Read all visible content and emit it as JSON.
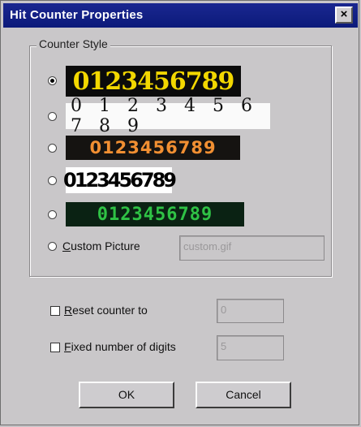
{
  "dialog": {
    "title": "Hit Counter Properties",
    "close_glyph": "×"
  },
  "counter_style": {
    "legend": "Counter Style",
    "options": [
      {
        "digits": "0123456789",
        "selected": true
      },
      {
        "digits": "0 1 2 3 4 5 6 7 8 9",
        "selected": false
      },
      {
        "digits": "0123456789",
        "selected": false
      },
      {
        "digits": "0123456789",
        "selected": false
      },
      {
        "digits": "0123456789",
        "selected": false
      }
    ],
    "custom": {
      "prefix": "C",
      "label_rest": "ustom Picture",
      "value": "custom.gif",
      "selected": false
    }
  },
  "reset_counter": {
    "prefix": "R",
    "label_rest": "eset counter to",
    "checked": false,
    "value": "0"
  },
  "fixed_digits": {
    "prefix": "F",
    "label_rest": "ixed number of digits",
    "checked": false,
    "value": "5"
  },
  "buttons": {
    "ok": "OK",
    "cancel": "Cancel"
  }
}
